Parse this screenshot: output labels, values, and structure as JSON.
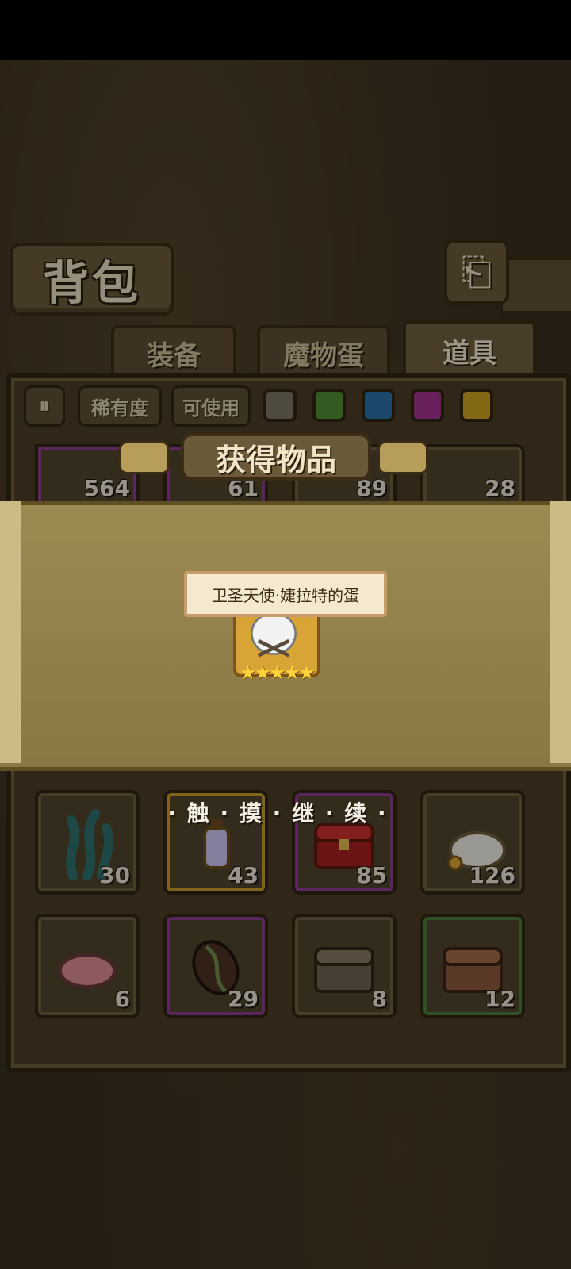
{
  "header": {
    "title": "背包",
    "back_icon": "back-icon"
  },
  "tabs": [
    {
      "label": "装备",
      "active": false
    },
    {
      "label": "魔物蛋",
      "active": false
    },
    {
      "label": "道具",
      "active": true
    }
  ],
  "filters": {
    "sort_icon": "sort-icon",
    "rarity_label": "稀有度",
    "usable_label": "可使用",
    "color_swatches": [
      "#7a7263",
      "#4f8a34",
      "#2c6fa6",
      "#a0328e",
      "#c9a023"
    ]
  },
  "top_row_counts": [
    "564",
    "61",
    "89",
    "28"
  ],
  "items": [
    {
      "icon": "seaweed-icon",
      "count": "30",
      "rarity": "normal"
    },
    {
      "icon": "lantern-icon",
      "count": "43",
      "rarity": "gold"
    },
    {
      "icon": "red-chest-icon",
      "count": "85",
      "rarity": "purple"
    },
    {
      "icon": "coin-sack-icon",
      "count": "126",
      "rarity": "normal"
    },
    {
      "icon": "meat-icon",
      "count": "6",
      "rarity": "normal"
    },
    {
      "icon": "cocoa-bean-icon",
      "count": "29",
      "rarity": "purple"
    },
    {
      "icon": "wooden-chest-icon",
      "count": "8",
      "rarity": "normal"
    },
    {
      "icon": "copper-chest-icon",
      "count": "12",
      "rarity": "green"
    }
  ],
  "popup": {
    "title": "获得物品",
    "item_name": "卫圣天使·婕拉特的蛋",
    "stars": "★★★★★",
    "touch_continue": "· 触 · 摸 · 继 · 续 ·"
  }
}
